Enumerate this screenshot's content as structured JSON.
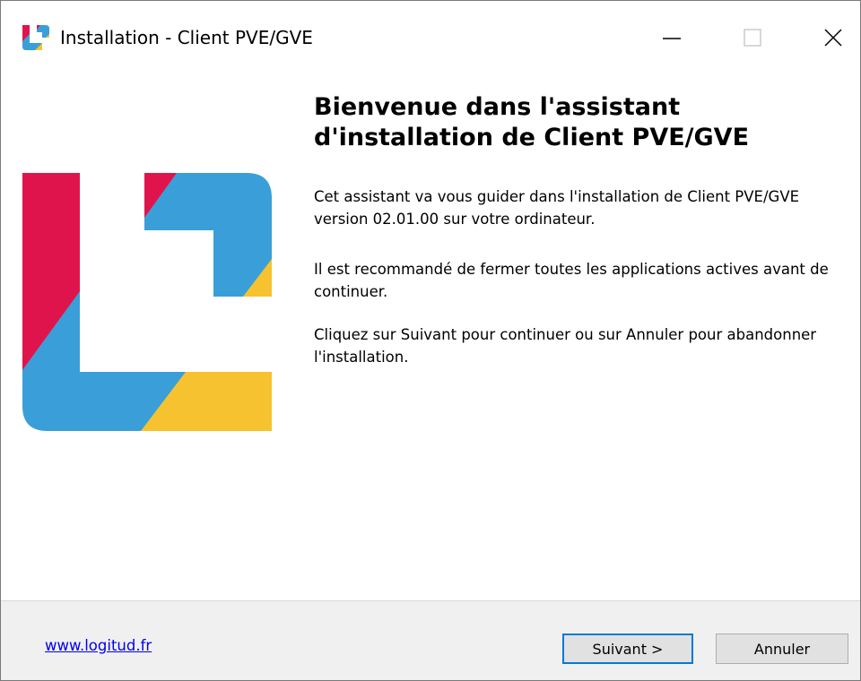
{
  "window": {
    "title": "Installation - Client PVE/GVE",
    "minimize_icon": "minimize-icon",
    "maximize_icon": "maximize-icon",
    "close_icon": "close-icon"
  },
  "hero": {
    "logo_icon": "logitud-logo-icon"
  },
  "content": {
    "title": "Bienvenue dans l'assistant d'installation de Client PVE/GVE",
    "paragraph1": "Cet assistant va vous guider dans l'installation de Client PVE/GVE version 02.01.00 sur votre ordinateur.",
    "paragraph2": "Il est recommandé de fermer toutes les applications actives avant de continuer.",
    "paragraph3": "Cliquez sur Suivant pour continuer ou sur Annuler pour abandonner l'installation."
  },
  "footer": {
    "link_text": "www.logitud.fr",
    "next_label": "Suivant >",
    "cancel_label": "Annuler"
  },
  "colors": {
    "brand_red": "#e0144c",
    "brand_blue": "#3a9fd8",
    "brand_yellow": "#f7c22f",
    "accent_focus": "#0078d7"
  }
}
